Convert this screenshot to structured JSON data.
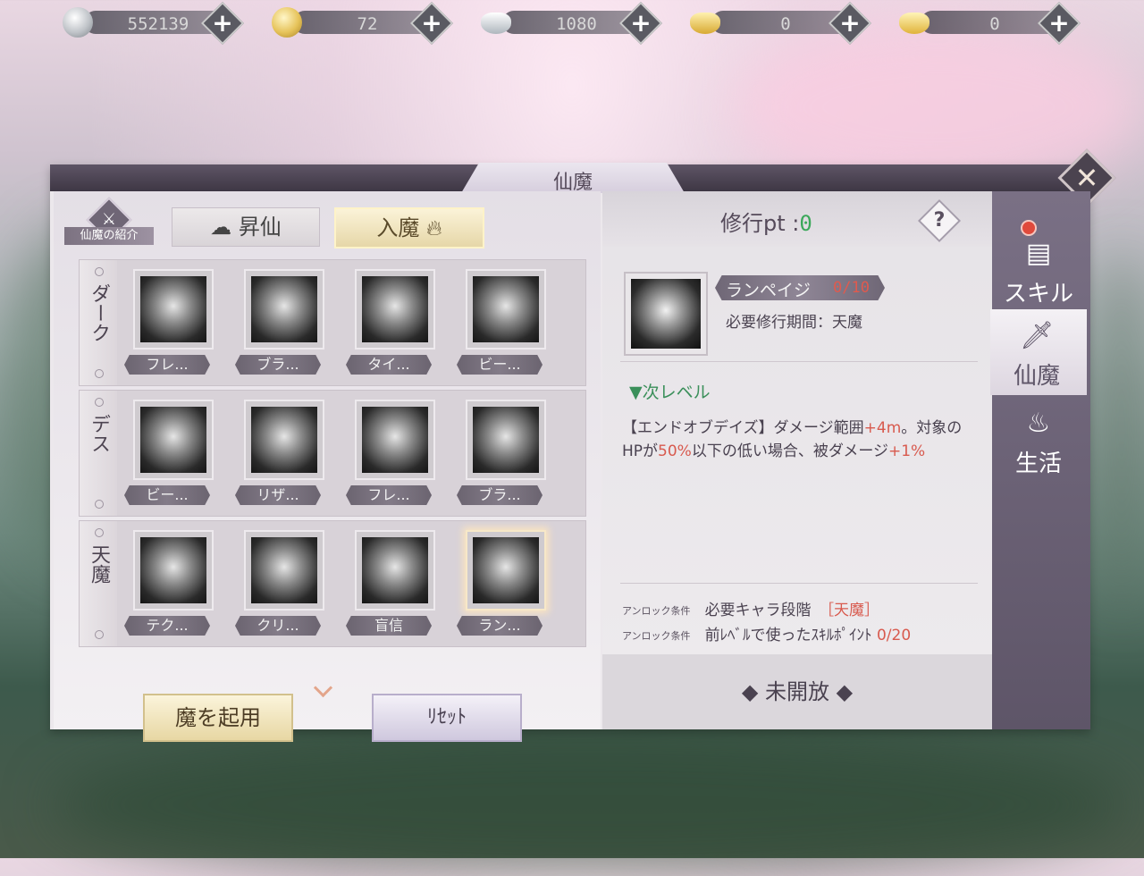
{
  "currencies": [
    {
      "icon": "silver-coin-icon",
      "value": "552139"
    },
    {
      "icon": "gold-coin-icon",
      "value": "72"
    },
    {
      "icon": "silver-ingot-icon",
      "value": "1080"
    },
    {
      "icon": "locked-gold-ingot-icon",
      "value": "0"
    },
    {
      "icon": "gold-ingot-icon",
      "value": "0"
    }
  ],
  "panel": {
    "title": "仙魔",
    "close_icon": "close-icon"
  },
  "left": {
    "intro_label": "仙魔の紹介",
    "tabs": [
      {
        "label": "昇仙",
        "icon": "cloud-icon",
        "active": false
      },
      {
        "label": "入魔",
        "icon": "flame-icon",
        "active": true
      }
    ],
    "groups": [
      {
        "label": "ダーク",
        "skills": [
          {
            "name": "フレ...",
            "icon": "fire-swirl-icon"
          },
          {
            "name": "ブラ...",
            "icon": "dagger-vortex-icon"
          },
          {
            "name": "タイ...",
            "icon": "lightning-burst-icon"
          },
          {
            "name": "ビー...",
            "icon": "beast-head-icon"
          }
        ]
      },
      {
        "label": "デス",
        "skills": [
          {
            "name": "ビー...",
            "icon": "vortex-icon"
          },
          {
            "name": "リザ...",
            "icon": "drop-icon"
          },
          {
            "name": "フレ...",
            "icon": "claw-slash-icon"
          },
          {
            "name": "ブラ...",
            "icon": "dark-drop-swirl-icon"
          }
        ]
      },
      {
        "label": "天魔",
        "skills": [
          {
            "name": "テク...",
            "icon": "orb-burst-icon"
          },
          {
            "name": "クリ...",
            "icon": "hammer-icon"
          },
          {
            "name": "盲信",
            "icon": "raised-arms-icon"
          },
          {
            "name": "ラン...",
            "icon": "storm-burst-icon",
            "selected": true
          }
        ]
      }
    ],
    "enable_button": "魔を起用",
    "reset_button": "ﾘｾｯﾄ"
  },
  "right": {
    "pt_label": "修行pt :",
    "pt_value": "0",
    "help_label": "?",
    "skill_name": "ランペイジ",
    "skill_level": "0/10",
    "required_period": "必要修行期間：天魔",
    "next_level_label": "▼次レベル",
    "desc_parts": [
      "【エンドオブデイズ】ダメージ範囲",
      "+4m",
      "。対象のHPが",
      "50%",
      "以下の低い場合、被ダメージ",
      "+1%"
    ],
    "unlock": [
      {
        "label": "アンロック条件",
        "text": "必要キャラ段階",
        "value": "［天魔］"
      },
      {
        "label": "アンロック条件",
        "text": "前ﾚﾍﾞﾙで使ったｽｷﾙﾎﾟｲﾝﾄ",
        "value": "0/20"
      }
    ],
    "status": "◆ 未開放 ◆"
  },
  "side_nav": [
    {
      "label": "スキル",
      "icon": "skill-book-icon",
      "active": false
    },
    {
      "label": "仙魔",
      "icon": "sword-flame-icon",
      "active": true
    },
    {
      "label": "生活",
      "icon": "cooking-pot-icon",
      "active": false
    }
  ],
  "colors": {
    "accent_green": "#3ba85a",
    "accent_red": "#d85a4e",
    "panel_bg": "#ece8ec",
    "side_nav": "#6a6174"
  }
}
